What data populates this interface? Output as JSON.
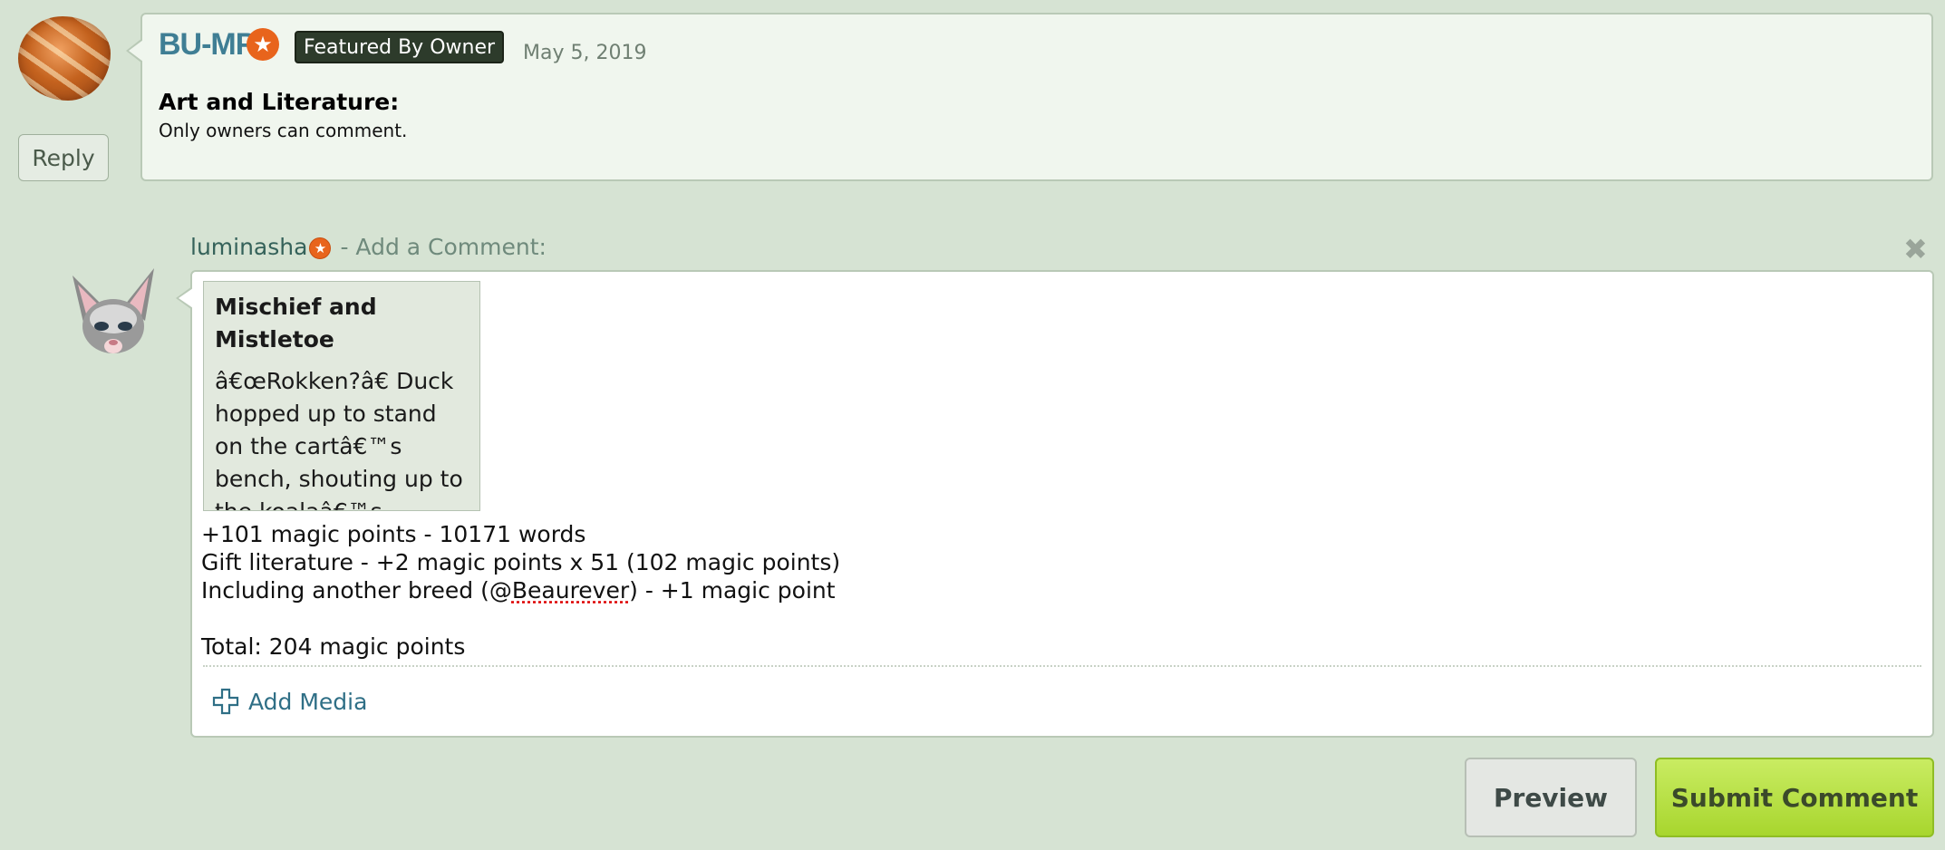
{
  "comment": {
    "username": "BU-MP",
    "badge": "Featured By Owner",
    "date": "May 5, 2019",
    "title": "Art and Literature:",
    "body": "Only owners can comment.",
    "reply_label": "Reply"
  },
  "composer": {
    "username": "luminasha",
    "label": "- Add a Comment:",
    "close_icon": "close-icon",
    "embed": {
      "title": "Mischief and Mistletoe",
      "excerpt": "â€œRokken?â€ Duck hopped up to stand on the cartâ€™s bench, shouting up to the koalaâ€™s crowded"
    },
    "lines": {
      "line1": "+101 magic points - 10171 words",
      "line2": "Gift literature - +2 magic points x 51 (102 magic points)",
      "line3_before": "Including another breed (@",
      "line3_mention": "Beaurever",
      "line3_after": ") - +1 magic point",
      "total": "Total: 204 magic points"
    },
    "add_media": "Add Media",
    "preview_label": "Preview",
    "submit_label": "Submit Comment"
  },
  "colors": {
    "page_bg": "#d6e3d3",
    "username": "#3f7e94",
    "star": "#e8641c",
    "submit": "#b6e03e"
  }
}
